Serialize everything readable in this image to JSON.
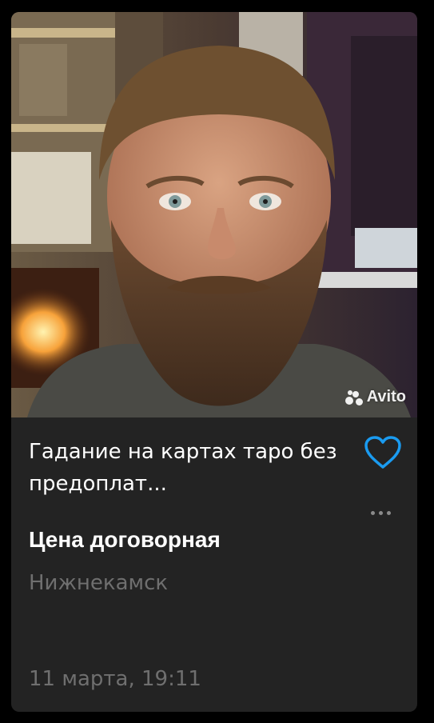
{
  "listing": {
    "title": "Гадание на картах таро без предоплат...",
    "price": "Цена договорная",
    "location": "Нижнекамск",
    "date": "11 марта, 19:11",
    "watermark": "Avito",
    "favorite_icon": "heart-outline-icon",
    "more_icon": "more-dots-icon"
  },
  "colors": {
    "background": "#000000",
    "card": "#232323",
    "accent": "#1a9bf0",
    "muted_text": "#6f6f6f"
  }
}
